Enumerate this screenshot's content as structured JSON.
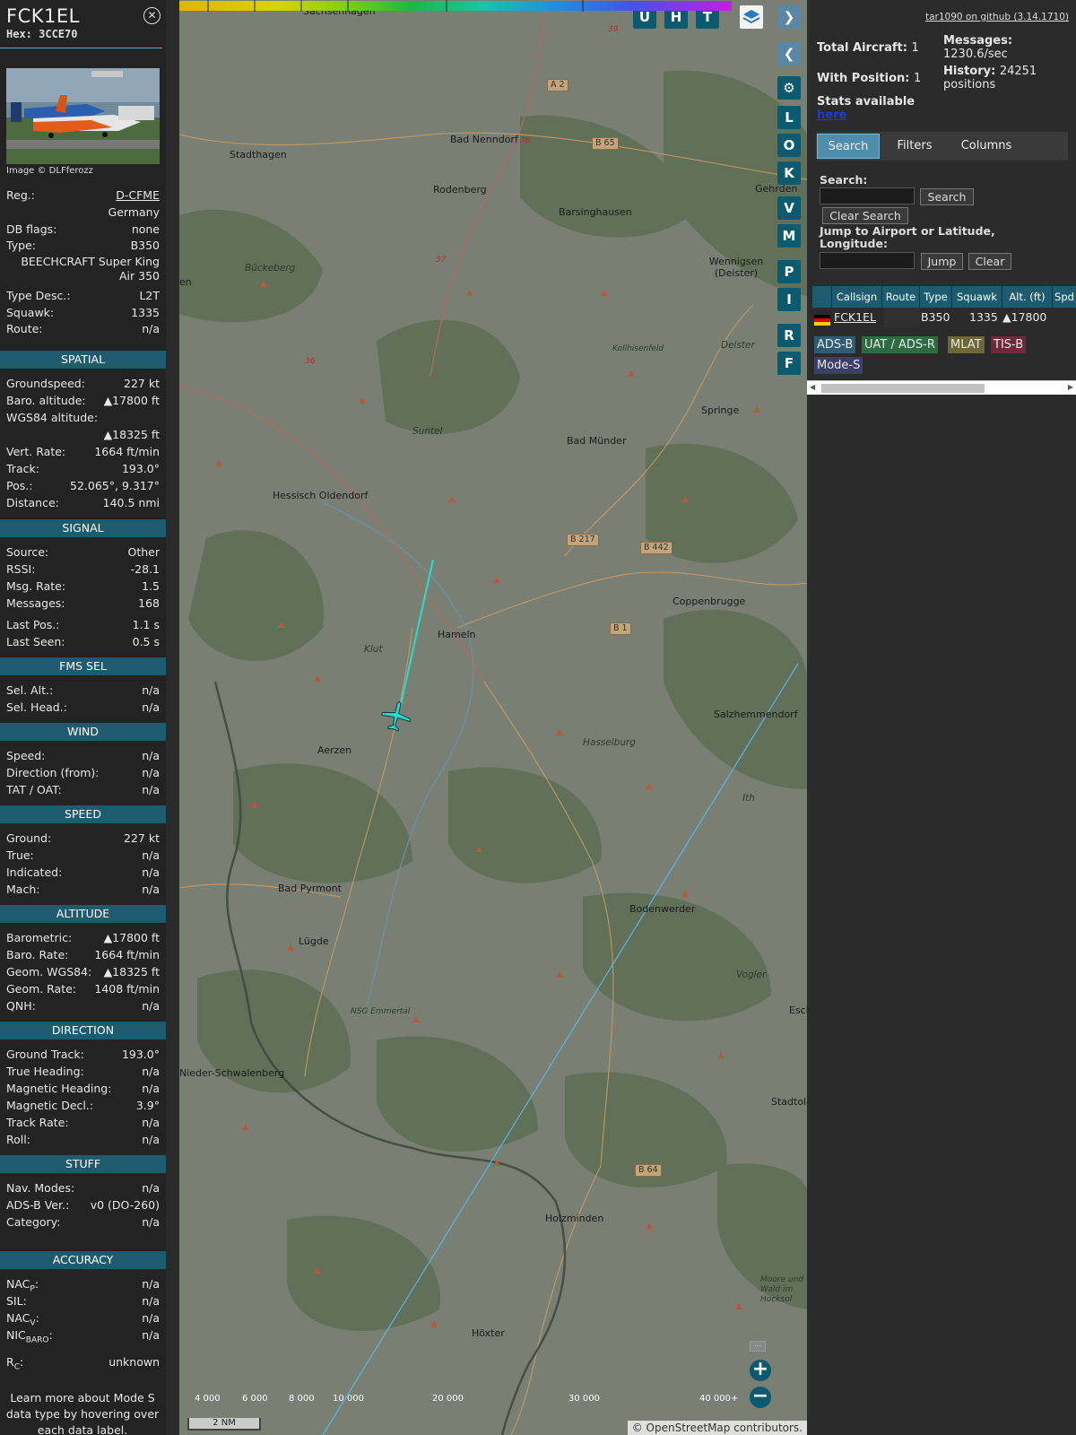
{
  "info": {
    "callsign": "FCK1EL",
    "hex": "Hex: 3CCE70",
    "credit": "Image © DLFferozz",
    "rows": [
      {
        "k": "Reg.:",
        "v": "D-CFME"
      },
      {
        "k": "",
        "v": "Germany"
      },
      {
        "k": "DB flags:",
        "v": "none"
      },
      {
        "k": "Type:",
        "v": "B350"
      },
      {
        "k": "",
        "v": "BEECHCRAFT Super King Air 350"
      },
      {
        "k": "Type Desc.:",
        "v": "L2T"
      },
      {
        "k": "Squawk:",
        "v": "1335"
      },
      {
        "k": "Route:",
        "v": "n/a"
      }
    ],
    "sections": {
      "spatial": "SPATIAL",
      "signal": "SIGNAL",
      "fms": "FMS SEL",
      "wind": "WIND",
      "speed": "SPEED",
      "altitude": "ALTITUDE",
      "direction": "DIRECTION",
      "stuff": "STUFF",
      "accuracy": "ACCURACY"
    },
    "spatial": [
      {
        "k": "Groundspeed:",
        "v": "227 kt"
      },
      {
        "k": "Baro. altitude:",
        "v": "▲17800 ft"
      },
      {
        "k": "WGS84 altitude:",
        "v": ""
      },
      {
        "k": "",
        "v": "▲18325 ft"
      },
      {
        "k": "Vert. Rate:",
        "v": "1664 ft/min"
      },
      {
        "k": "Track:",
        "v": "193.0°"
      },
      {
        "k": "Pos.:",
        "v": "52.065°, 9.317°"
      },
      {
        "k": "Distance:",
        "v": "140.5 nmi"
      }
    ],
    "signal": [
      {
        "k": "Source:",
        "v": "Other"
      },
      {
        "k": "RSSI:",
        "v": "-28.1"
      },
      {
        "k": "Msg. Rate:",
        "v": "1.5"
      },
      {
        "k": "Messages:",
        "v": "168"
      },
      {
        "k": "Last Pos.:",
        "v": "1.1 s"
      },
      {
        "k": "Last Seen:",
        "v": "0.5 s"
      }
    ],
    "fms": [
      {
        "k": "Sel. Alt.:",
        "v": "n/a"
      },
      {
        "k": "Sel. Head.:",
        "v": "n/a"
      }
    ],
    "wind": [
      {
        "k": "Speed:",
        "v": "n/a"
      },
      {
        "k": "Direction (from):",
        "v": "n/a"
      },
      {
        "k": "TAT / OAT:",
        "v": "n/a"
      }
    ],
    "speed": [
      {
        "k": "Ground:",
        "v": "227 kt"
      },
      {
        "k": "True:",
        "v": "n/a"
      },
      {
        "k": "Indicated:",
        "v": "n/a"
      },
      {
        "k": "Mach:",
        "v": "n/a"
      }
    ],
    "altitude": [
      {
        "k": "Barometric:",
        "v": "▲17800 ft"
      },
      {
        "k": "Baro. Rate:",
        "v": "1664 ft/min"
      },
      {
        "k": "Geom. WGS84:",
        "v": "▲18325 ft"
      },
      {
        "k": "Geom. Rate:",
        "v": "1408 ft/min"
      },
      {
        "k": "QNH:",
        "v": "n/a"
      }
    ],
    "direction": [
      {
        "k": "Ground Track:",
        "v": "193.0°"
      },
      {
        "k": "True Heading:",
        "v": "n/a"
      },
      {
        "k": "Magnetic Heading:",
        "v": "n/a"
      },
      {
        "k": "Magnetic Decl.:",
        "v": "3.9°"
      },
      {
        "k": "Track Rate:",
        "v": "n/a"
      },
      {
        "k": "Roll:",
        "v": "n/a"
      }
    ],
    "stuff": [
      {
        "k": "Nav. Modes:",
        "v": "n/a"
      },
      {
        "k": "ADS-B Ver.:",
        "v": "v0 (DO-260)"
      },
      {
        "k": "Category:",
        "v": "n/a"
      }
    ],
    "accuracy": [
      {
        "k": "NAC",
        "sub": "P",
        "v": "n/a"
      },
      {
        "k": "SIL:",
        "sub": "",
        "v": "n/a"
      },
      {
        "k": "NAC",
        "sub": "V",
        "v": "n/a"
      },
      {
        "k": "NIC",
        "sub": "BARO",
        "v": "n/a"
      },
      {
        "k": "R",
        "sub": "C",
        "v": "unknown"
      }
    ],
    "learn": "Learn more about Mode S data type by hovering over each data label."
  },
  "map": {
    "places": [
      "Sachsenhagen",
      "Stadthagen",
      "Bad Nenndorf",
      "Rodenberg",
      "Barsinghausen",
      "Gehrden",
      "Wennigsen (Deister)",
      "Bückeberg",
      "Deister",
      "Kollhisenfeld",
      "Springe",
      "Suntel",
      "Bad Münder",
      "Hessisch Oldendorf",
      "Coppenbrugge",
      "Hameln",
      "Klut",
      "Salzhemmendorf",
      "Aerzen",
      "Hasselburg",
      "Ith",
      "Bad Pyrmont",
      "Bodenwerder",
      "Lügde",
      "Vogler",
      "NSG Emmertal",
      "Esch",
      "Nieder-Schwalenberg",
      "Stadtole",
      "Holzminden",
      "Höxter",
      "Moore und Wald im Hocksol",
      "en"
    ],
    "shields": [
      "A 2",
      "B 65",
      "B 217",
      "B 442",
      "B 1",
      "B 64",
      "38",
      "37",
      "36",
      "39"
    ],
    "buttons": [
      "U",
      "H",
      "T",
      "L",
      "O",
      "K",
      "V",
      "M",
      "P",
      "I",
      "R",
      "F"
    ],
    "legend_labels": [
      "4 000",
      "6 000",
      "8 000",
      "10 000",
      "20 000",
      "30 000",
      "40 000+"
    ],
    "scale": "2 NM",
    "attribution": "© OpenStreetMap contributors."
  },
  "side": {
    "github": "tar1090 on github (3.14.1710)",
    "total_aircraft_label": "Total Aircraft:",
    "total_aircraft": "1",
    "with_position_label": "With Position:",
    "with_position": "1",
    "messages_label": "Messages:",
    "messages_rate": "1230.6/sec",
    "history_label": "History:",
    "history": "24251 positions",
    "stats_label": "Stats available",
    "stats_link": "here",
    "tabs": [
      "Search",
      "Filters",
      "Columns"
    ],
    "search_label": "Search:",
    "search_btn": "Search",
    "clear_search_btn": "Clear Search",
    "jump_label": "Jump to Airport or Latitude, Longitude:",
    "jump_btn": "Jump",
    "clear_btn": "Clear",
    "columns": [
      "",
      "Callsign",
      "Route",
      "Type",
      "Squawk",
      "Alt. (ft)",
      "Spd"
    ],
    "row": {
      "callsign": "FCK1EL",
      "route": "",
      "type": "B350",
      "squawk": "1335",
      "alt": "▲17800"
    },
    "badges": [
      "ADS-B",
      "UAT / ADS-R",
      "MLAT",
      "TIS-B",
      "Mode-S"
    ]
  }
}
